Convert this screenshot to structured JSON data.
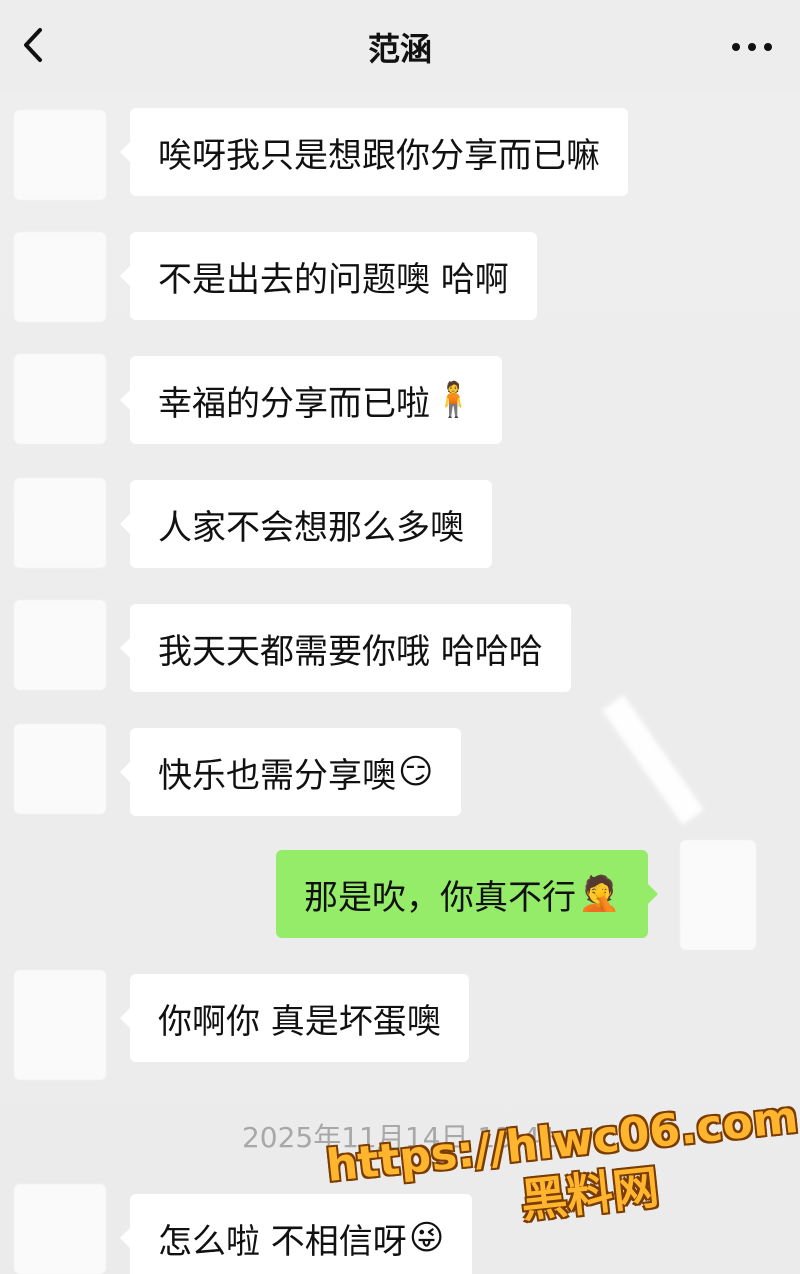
{
  "header": {
    "title": "范涵",
    "back_icon": "chevron-left-icon",
    "more_icon": "more-horizontal-icon"
  },
  "messages": [
    {
      "side": "left",
      "text": "唉呀我只是想跟你分享而已嘛"
    },
    {
      "side": "left",
      "text": "不是出去的问题噢 哈啊"
    },
    {
      "side": "left",
      "text": "幸福的分享而已啦",
      "emoji": "🧍"
    },
    {
      "side": "left",
      "text": "人家不会想那么多噢"
    },
    {
      "side": "left",
      "text": "我天天都需要你哦 哈哈哈"
    },
    {
      "side": "left",
      "text": "快乐也需分享噢",
      "emoji": "😏"
    },
    {
      "side": "right",
      "text": "那是吹，你真不行",
      "emoji": "🤦"
    },
    {
      "side": "left",
      "text": "你啊你 真是坏蛋噢"
    },
    {
      "side": "left",
      "text": "怎么啦 不相信呀",
      "emoji": "😜"
    }
  ],
  "timestamp": "2025年11月14日 13:41",
  "watermark": {
    "url": "https://hlwc06.com",
    "name": "黑料网"
  },
  "colors": {
    "background": "#ededed",
    "incoming_bubble": "#ffffff",
    "outgoing_bubble": "#95ec69",
    "timestamp": "#a8a8a8",
    "watermark": "#ffb52d"
  }
}
